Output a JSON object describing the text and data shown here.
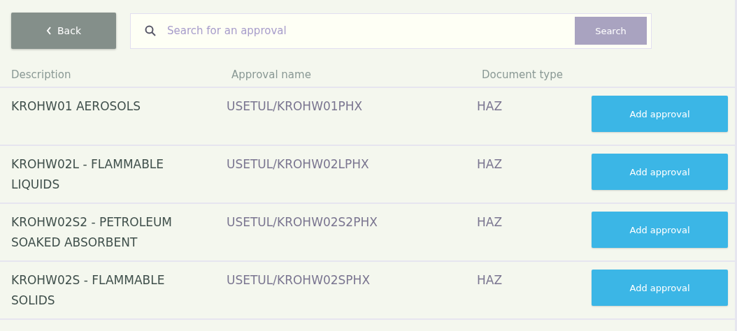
{
  "back_button": {
    "label": "Back"
  },
  "search": {
    "placeholder": "Search for an approval",
    "button": "Search"
  },
  "table": {
    "columns": [
      "Description",
      "Approval name",
      "Document type"
    ],
    "rows": [
      {
        "description": "KROHW01 AEROSOLS",
        "approval_name": "USETUL/KROHW01PHX",
        "document_type": "HAZ",
        "action": "Add approval"
      },
      {
        "description": "KROHW02L - FLAMMABLE LIQUIDS",
        "approval_name": "USETUL/KROHW02LPHX",
        "document_type": "HAZ",
        "action": "Add approval"
      },
      {
        "description": "KROHW02S2 - PETROLEUM SOAKED ABSORBENT",
        "approval_name": "USETUL/KROHW02S2PHX",
        "document_type": "HAZ",
        "action": "Add approval"
      },
      {
        "description": "KROHW02S - FLAMMABLE SOLIDS",
        "approval_name": "USETUL/KROHW02SPHX",
        "document_type": "HAZ",
        "action": "Add approval"
      }
    ]
  }
}
